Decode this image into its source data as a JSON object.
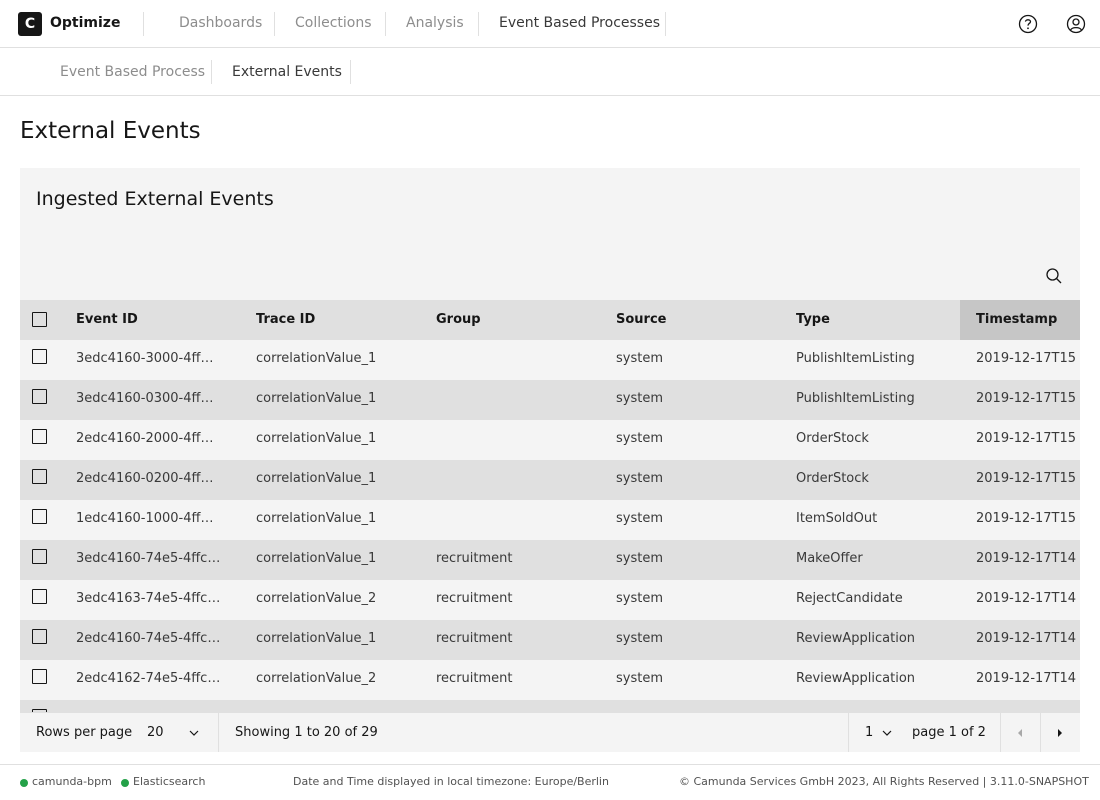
{
  "header": {
    "logo_letter": "C",
    "app_name": "Optimize",
    "nav": [
      "Dashboards",
      "Collections",
      "Analysis",
      "Event Based Processes"
    ],
    "help_icon": "help-icon",
    "user_icon": "user-icon"
  },
  "subnav": {
    "items": [
      "Event Based Process",
      "External Events"
    ]
  },
  "page": {
    "title": "External Events"
  },
  "table": {
    "title": "Ingested External Events",
    "search_icon": "search-icon",
    "columns": [
      "Event ID",
      "Trace ID",
      "Group",
      "Source",
      "Type",
      "Timestamp"
    ],
    "rows": [
      [
        "3edc4160-3000-4ff…",
        "correlationValue_1",
        "",
        "system",
        "PublishItemListing",
        "2019-12-17T15"
      ],
      [
        "3edc4160-0300-4ff…",
        "correlationValue_1",
        "",
        "system",
        "PublishItemListing",
        "2019-12-17T15"
      ],
      [
        "2edc4160-2000-4ff…",
        "correlationValue_1",
        "",
        "system",
        "OrderStock",
        "2019-12-17T15"
      ],
      [
        "2edc4160-0200-4ff…",
        "correlationValue_1",
        "",
        "system",
        "OrderStock",
        "2019-12-17T15"
      ],
      [
        "1edc4160-1000-4ff…",
        "correlationValue_1",
        "",
        "system",
        "ItemSoldOut",
        "2019-12-17T15"
      ],
      [
        "3edc4160-74e5-4ffc…",
        "correlationValue_1",
        "recruitment",
        "system",
        "MakeOffer",
        "2019-12-17T14"
      ],
      [
        "3edc4163-74e5-4ffc…",
        "correlationValue_2",
        "recruitment",
        "system",
        "RejectCandidate",
        "2019-12-17T14"
      ],
      [
        "2edc4160-74e5-4ffc…",
        "correlationValue_1",
        "recruitment",
        "system",
        "ReviewApplication",
        "2019-12-17T14"
      ],
      [
        "2edc4162-74e5-4ffc…",
        "correlationValue_2",
        "recruitment",
        "system",
        "ReviewApplication",
        "2019-12-17T14"
      ]
    ]
  },
  "pagination": {
    "rows_per_page_label": "Rows per page",
    "rows_per_page_value": "20",
    "showing": "Showing 1 to 20 of 29",
    "page_value": "1",
    "page_of": "page 1 of 2"
  },
  "footer": {
    "status": [
      {
        "label": "camunda-bpm",
        "color": "#24a148"
      },
      {
        "label": "Elasticsearch",
        "color": "#24a148"
      }
    ],
    "timezone": "Date and Time displayed in local timezone: Europe/Berlin",
    "copyright": "© Camunda Services GmbH 2023, All Rights Reserved | 3.11.0-SNAPSHOT"
  }
}
